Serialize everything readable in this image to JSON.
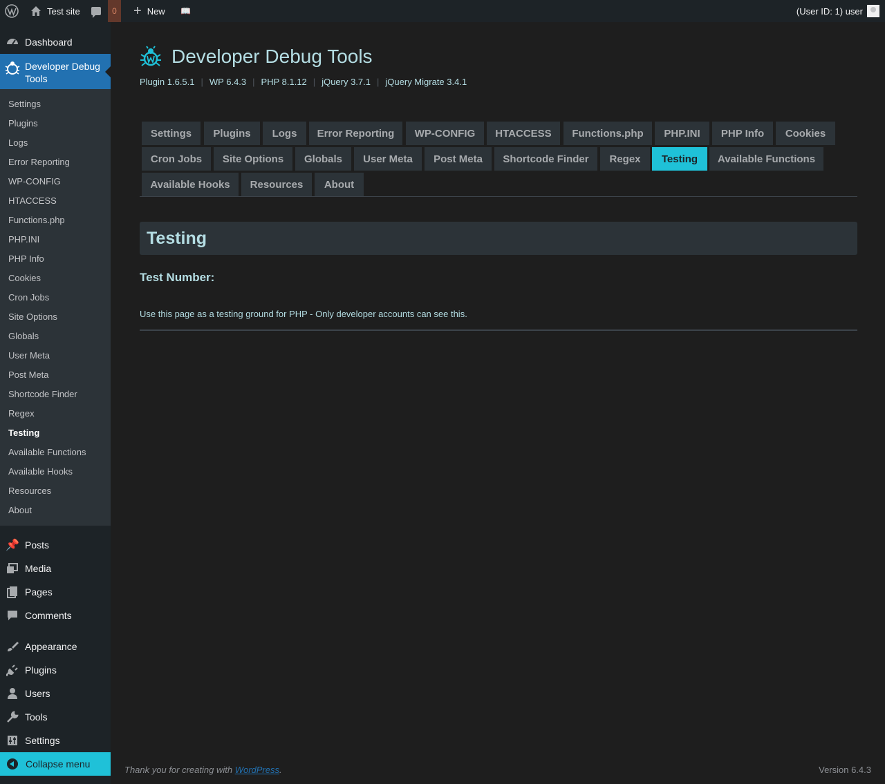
{
  "adminbar": {
    "site_name": "Test site",
    "comments_count": "0",
    "new_label": "New",
    "user_label": "(User ID: 1) user"
  },
  "sidebar": {
    "dashboard": "Dashboard",
    "active_menu": "Developer Debug Tools",
    "submenu": [
      "Settings",
      "Plugins",
      "Logs",
      "Error Reporting",
      "WP-CONFIG",
      "HTACCESS",
      "Functions.php",
      "PHP.INI",
      "PHP Info",
      "Cookies",
      "Cron Jobs",
      "Site Options",
      "Globals",
      "User Meta",
      "Post Meta",
      "Shortcode Finder",
      "Regex",
      "Testing",
      "Available Functions",
      "Available Hooks",
      "Resources",
      "About"
    ],
    "current_sub": "Testing",
    "menu": [
      {
        "label": "Posts",
        "icon": "pin-icon"
      },
      {
        "label": "Media",
        "icon": "media-icon"
      },
      {
        "label": "Pages",
        "icon": "pages-icon"
      },
      {
        "label": "Comments",
        "icon": "comments-icon"
      },
      {
        "label": "Appearance",
        "icon": "brush-icon"
      },
      {
        "label": "Plugins",
        "icon": "plugin-icon"
      },
      {
        "label": "Users",
        "icon": "users-icon"
      },
      {
        "label": "Tools",
        "icon": "wrench-icon"
      },
      {
        "label": "Settings",
        "icon": "settings-icon"
      }
    ],
    "collapse_label": "Collapse menu"
  },
  "header": {
    "title": "Developer Debug Tools",
    "versions": [
      "Plugin 1.6.5.1",
      "WP 6.4.3",
      "PHP 8.1.12",
      "jQuery 3.7.1",
      "jQuery Migrate 3.4.1"
    ]
  },
  "tabs": [
    "Settings",
    "Plugins",
    "Logs",
    "Error Reporting",
    "WP-CONFIG",
    "HTACCESS",
    "Functions.php",
    "PHP.INI",
    "PHP Info",
    "Cookies",
    "Cron Jobs",
    "Site Options",
    "Globals",
    "User Meta",
    "Post Meta",
    "Shortcode Finder",
    "Regex",
    "Testing",
    "Available Functions",
    "Available Hooks",
    "Resources",
    "About"
  ],
  "active_tab": "Testing",
  "content": {
    "section_title": "Testing",
    "test_number_label": "Test Number:",
    "note": "Use this page as a testing ground for PHP - Only developer accounts can see this."
  },
  "footer": {
    "thanks_prefix": "Thank you for creating with ",
    "thanks_link": "WordPress",
    "thanks_suffix": ".",
    "version": "Version 6.4.3"
  },
  "colors": {
    "accent": "#1fc1d8",
    "admin_bar": "#1d2327",
    "active_menu": "#2271b1"
  }
}
